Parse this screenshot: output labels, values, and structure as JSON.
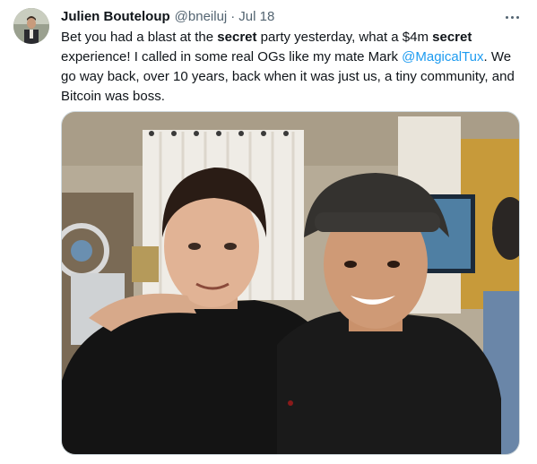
{
  "tweet": {
    "author_name": "Julien Bouteloup",
    "author_handle": "@bneiluj",
    "separator": "·",
    "date": "Jul 18",
    "more_icon": "more-horizontal-icon",
    "body": {
      "segment_1": "Bet you had a blast at the ",
      "keyword_1": "secret",
      "segment_2": " party yesterday, what a $4m ",
      "keyword_2": "secret",
      "segment_3": " experience! I called in some real OGs like my mate Mark ",
      "mention": "@MagicalTux",
      "segment_4": ". We go way back, over 10 years, back when it was just us, a tiny community, and Bitcoin was boss."
    },
    "media": {
      "kind": "photo"
    }
  },
  "colors": {
    "text_primary": "#0f1419",
    "text_secondary": "#536471",
    "link": "#1d9bf0",
    "border": "#cfd9de"
  }
}
